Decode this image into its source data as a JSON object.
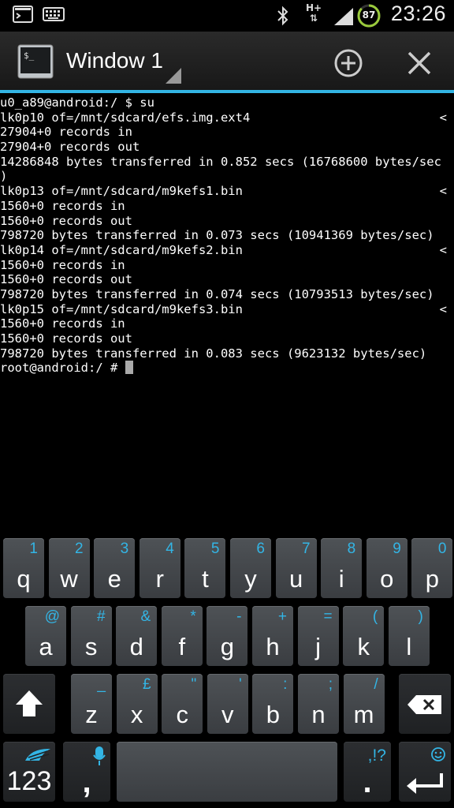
{
  "status_bar": {
    "network_type": "H+",
    "battery_percent": "87",
    "time": "23:26",
    "icons": [
      "terminal-notification-icon",
      "keyboard-notification-icon",
      "bluetooth-icon",
      "network-hplus-icon",
      "signal-icon",
      "battery-icon"
    ]
  },
  "action_bar": {
    "window_title": "Window 1",
    "accent_color": "#33b5e5"
  },
  "terminal": {
    "lines": [
      {
        "text": "u0_a89@android:/ $ su",
        "cont": ""
      },
      {
        "text": "lk0p10 of=/mnt/sdcard/efs.img.ext4",
        "cont": "<"
      },
      {
        "text": "27904+0 records in",
        "cont": ""
      },
      {
        "text": "27904+0 records out",
        "cont": ""
      },
      {
        "text": "14286848 bytes transferred in 0.852 secs (16768600 bytes/sec",
        "cont": ""
      },
      {
        "text": ")",
        "cont": ""
      },
      {
        "text": "lk0p13 of=/mnt/sdcard/m9kefs1.bin",
        "cont": "<"
      },
      {
        "text": "1560+0 records in",
        "cont": ""
      },
      {
        "text": "1560+0 records out",
        "cont": ""
      },
      {
        "text": "798720 bytes transferred in 0.073 secs (10941369 bytes/sec)",
        "cont": ""
      },
      {
        "text": "lk0p14 of=/mnt/sdcard/m9kefs2.bin",
        "cont": "<"
      },
      {
        "text": "1560+0 records in",
        "cont": ""
      },
      {
        "text": "1560+0 records out",
        "cont": ""
      },
      {
        "text": "798720 bytes transferred in 0.074 secs (10793513 bytes/sec)",
        "cont": ""
      },
      {
        "text": "lk0p15 of=/mnt/sdcard/m9kefs3.bin",
        "cont": "<"
      },
      {
        "text": "1560+0 records in",
        "cont": ""
      },
      {
        "text": "1560+0 records out",
        "cont": ""
      },
      {
        "text": "798720 bytes transferred in 0.083 secs (9623132 bytes/sec)",
        "cont": ""
      }
    ],
    "prompt": "root@android:/ # "
  },
  "keyboard": {
    "row1": [
      {
        "k": "q",
        "s": "1"
      },
      {
        "k": "w",
        "s": "2"
      },
      {
        "k": "e",
        "s": "3"
      },
      {
        "k": "r",
        "s": "4"
      },
      {
        "k": "t",
        "s": "5"
      },
      {
        "k": "y",
        "s": "6"
      },
      {
        "k": "u",
        "s": "7"
      },
      {
        "k": "i",
        "s": "8"
      },
      {
        "k": "o",
        "s": "9"
      },
      {
        "k": "p",
        "s": "0"
      }
    ],
    "row2": [
      {
        "k": "a",
        "s": "@"
      },
      {
        "k": "s",
        "s": "#"
      },
      {
        "k": "d",
        "s": "&"
      },
      {
        "k": "f",
        "s": "*"
      },
      {
        "k": "g",
        "s": "-"
      },
      {
        "k": "h",
        "s": "+"
      },
      {
        "k": "j",
        "s": "="
      },
      {
        "k": "k",
        "s": "("
      },
      {
        "k": "l",
        "s": ")"
      }
    ],
    "row3": [
      {
        "k": "z",
        "s": "_"
      },
      {
        "k": "x",
        "s": "£"
      },
      {
        "k": "c",
        "s": "\""
      },
      {
        "k": "v",
        "s": "'"
      },
      {
        "k": "b",
        "s": ":"
      },
      {
        "k": "n",
        "s": ";"
      },
      {
        "k": "m",
        "s": "/"
      }
    ],
    "symbols_label": "123",
    "comma_label": ",",
    "period_label": ".",
    "period_secondary": ",!?"
  }
}
